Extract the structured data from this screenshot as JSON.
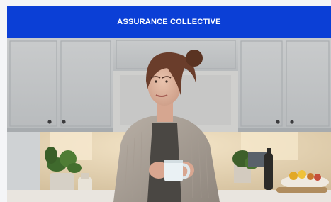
{
  "header": {
    "brand_name": "ASSURANCE COLLECTIVE",
    "background_color": "#0b3fd6",
    "text_color": "#ffffff"
  },
  "hero": {
    "image_subject": "woman-holding-mug-in-kitchen"
  }
}
